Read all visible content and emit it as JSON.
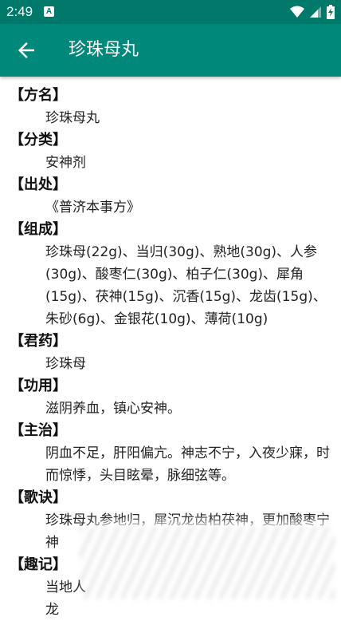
{
  "status": {
    "time": "2:49",
    "notification_icon": "A"
  },
  "appbar": {
    "title": "珍珠母丸",
    "back_icon": "arrow-left-icon"
  },
  "sections": [
    {
      "label": "【方名】",
      "value": "珍珠母丸"
    },
    {
      "label": "【分类】",
      "value": "安神剂"
    },
    {
      "label": "【出处】",
      "value": "《普济本事方》"
    },
    {
      "label": "【组成】",
      "value": "珍珠母(22g)、当归(30g)、熟地(30g)、人参(30g)、酸枣仁(30g)、柏子仁(30g)、犀角(15g)、茯神(15g)、沉香(15g)、龙齿(15g)、朱砂(6g)、金银花(10g)、薄荷(10g)"
    },
    {
      "label": "【君药】",
      "value": "珍珠母"
    },
    {
      "label": "【功用】",
      "value": "滋阴养血，镇心安神。"
    },
    {
      "label": "【主治】",
      "value": "阴血不足，肝阳偏亢。神志不宁，入夜少寐，时而惊悸，头目眩晕，脉细弦等。"
    },
    {
      "label": "【歌诀】",
      "value": "珍珠母丸参地归，犀沉龙齿柏茯神，更加酸枣宁神"
    },
    {
      "label": "【趣记】",
      "value": "当地人"
    }
  ],
  "trailing_text": "龙",
  "colors": {
    "status_bar": "#00796b",
    "app_bar": "#00897b"
  }
}
